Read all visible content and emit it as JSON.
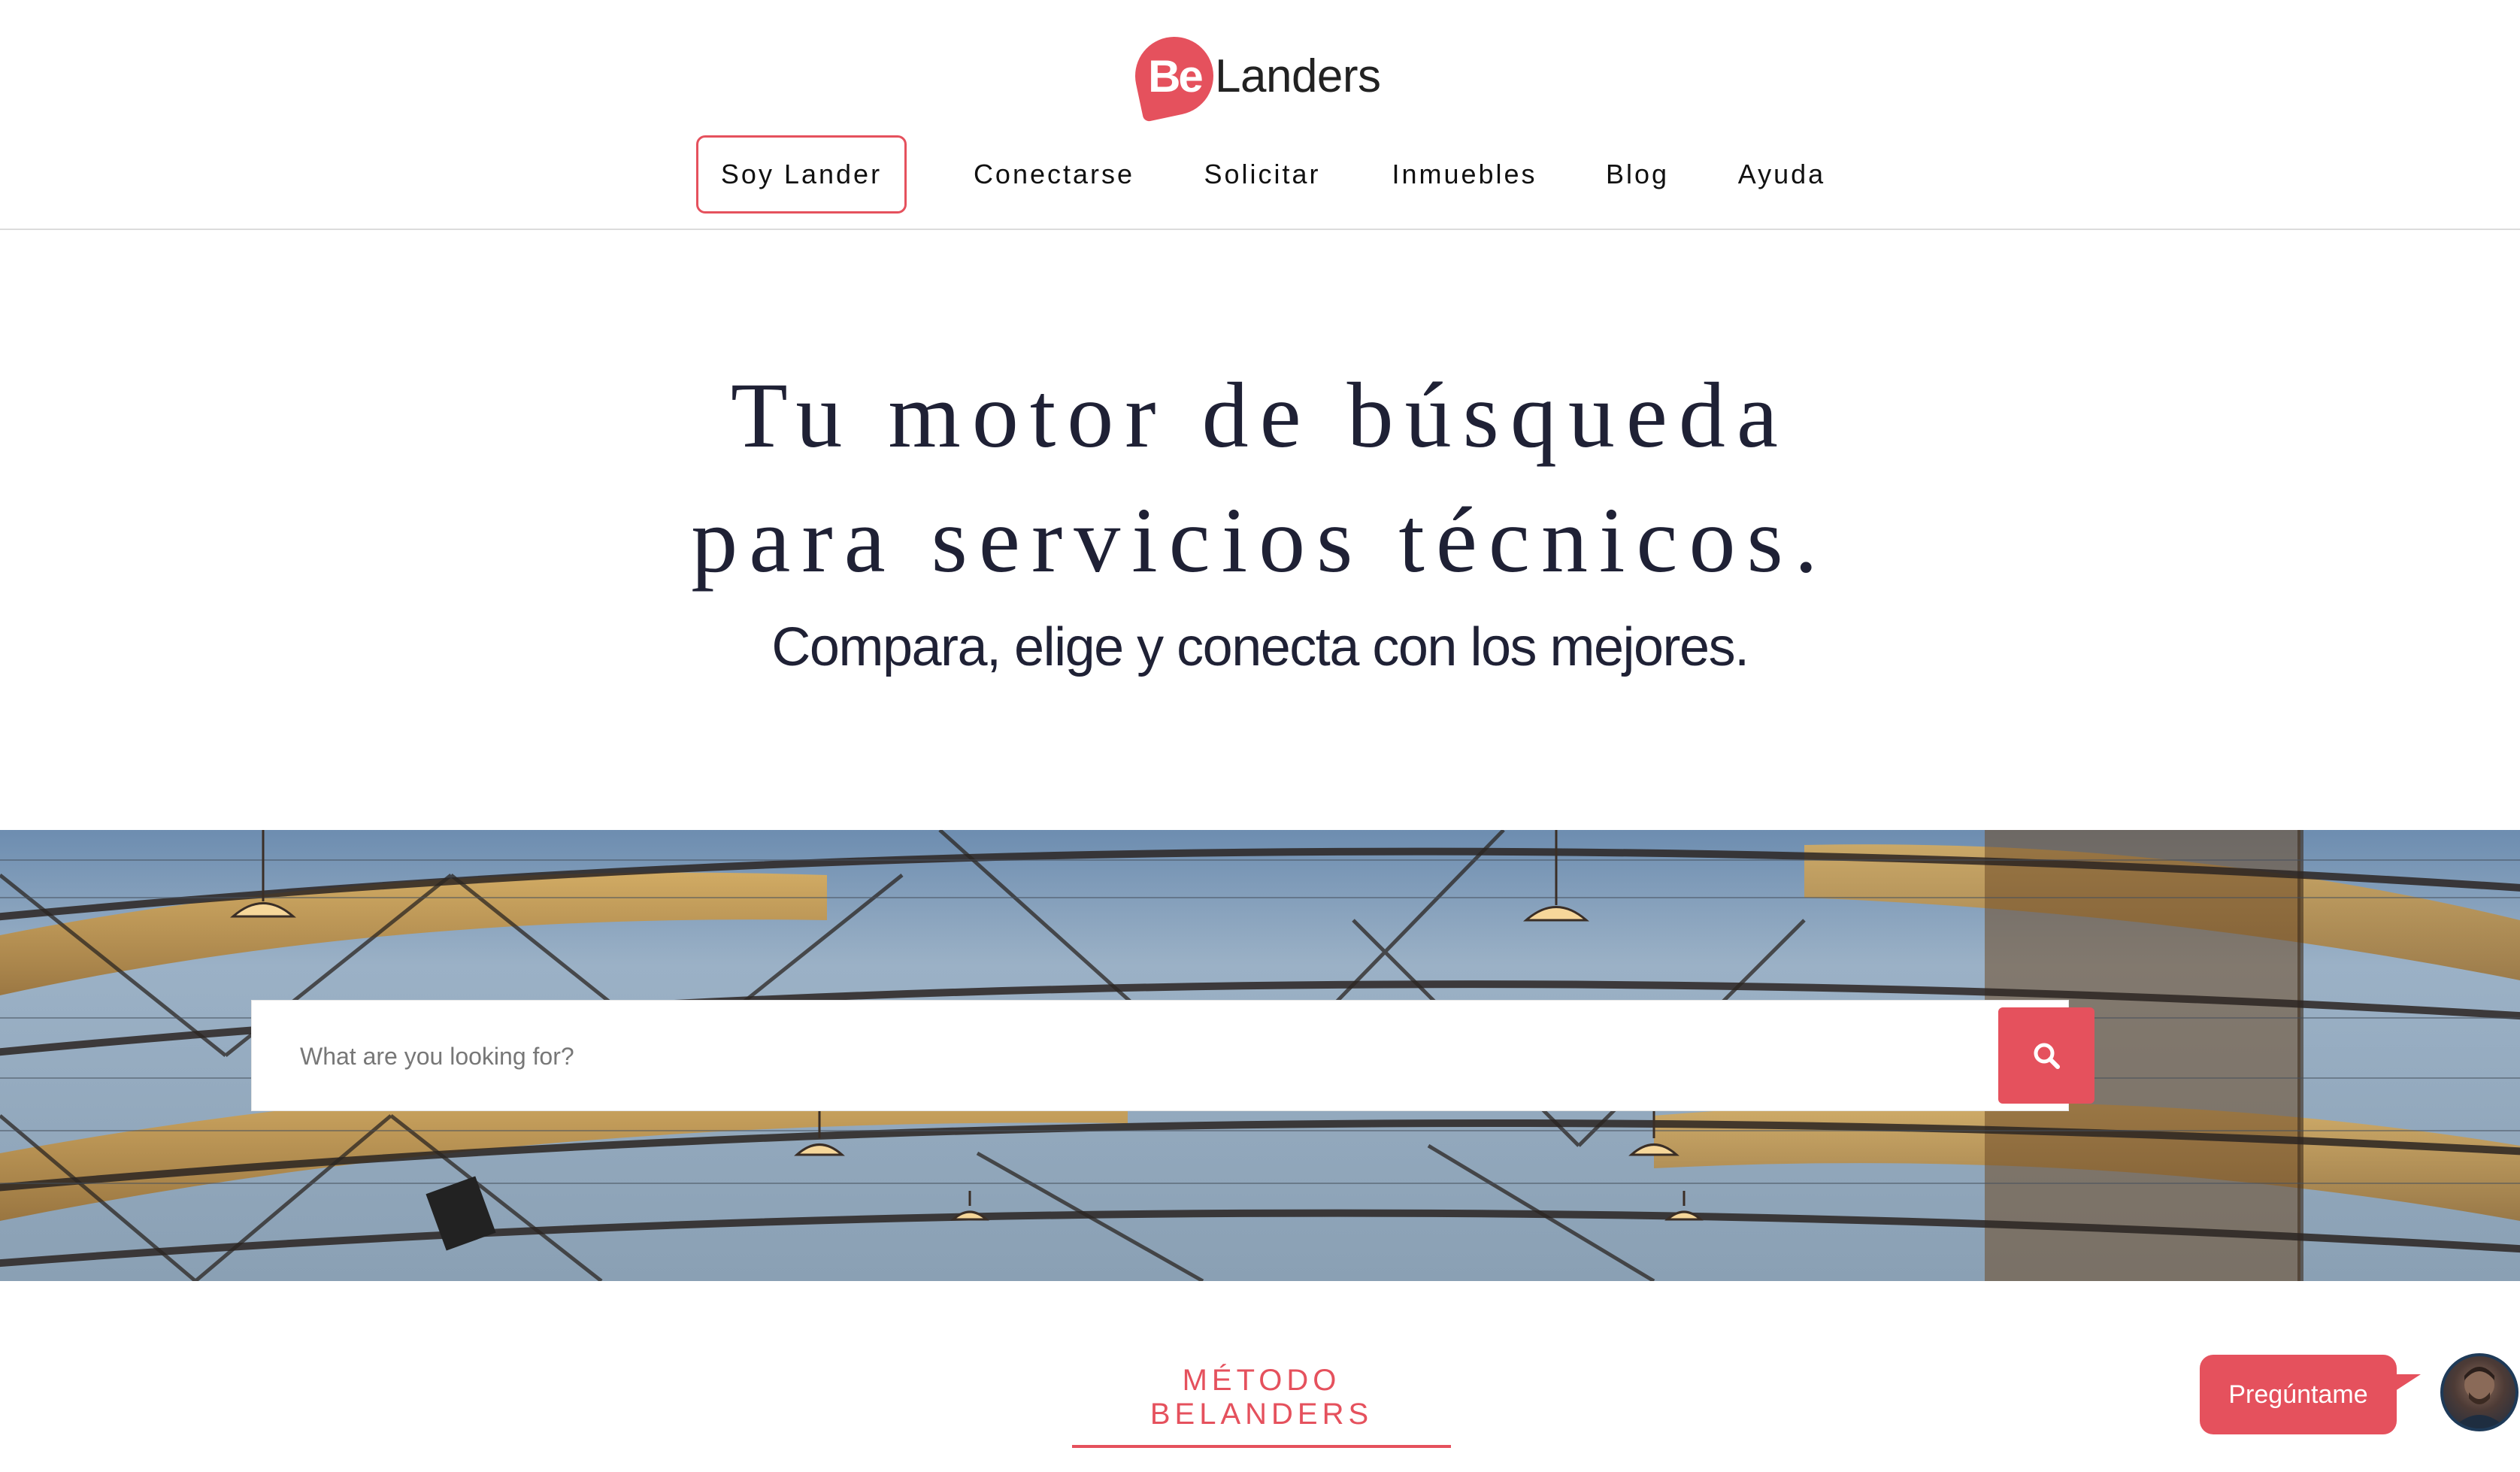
{
  "logo": {
    "badge_text": "Be",
    "word": "Landers"
  },
  "nav": {
    "items": [
      {
        "label": "Soy Lander",
        "active": true
      },
      {
        "label": "Conectarse",
        "active": false
      },
      {
        "label": "Solicitar",
        "active": false
      },
      {
        "label": "Inmuebles",
        "active": false
      },
      {
        "label": "Blog",
        "active": false
      },
      {
        "label": "Ayuda",
        "active": false
      }
    ]
  },
  "hero": {
    "title_line1": "Tu motor de búsqueda",
    "title_line2": "para servicios técnicos.",
    "subtitle": "Compara, elige y conecta con los mejores."
  },
  "search": {
    "placeholder": "What are you looking for?",
    "button_icon": "search-icon"
  },
  "method": {
    "heading": "MÉTODO BELANDERS"
  },
  "chat": {
    "label": "Pregúntame",
    "avatar_icon": "user-avatar"
  },
  "colors": {
    "accent": "#e5515d",
    "text_dark": "#1f2135"
  }
}
